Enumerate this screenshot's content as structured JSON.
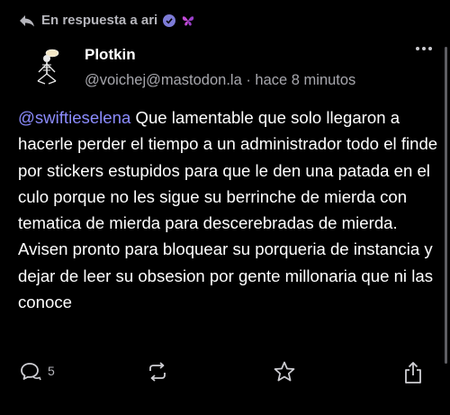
{
  "reply_context": {
    "label": "En respuesta a ari",
    "arrow_icon": "reply-arrow-icon",
    "badges": [
      "verified-check-icon",
      "butterfly-emoji-icon"
    ]
  },
  "author": {
    "display_name": "Plotkin",
    "handle_and_time": "@voichej@mastodon.la · hace 8 minutos"
  },
  "post": {
    "mention": "@swiftieselena",
    "text": " Que lamentable que solo llegaron a hacerle perder el tiempo a un administrador todo el finde por stickers estupidos para que le den una patada en el culo porque no les sigue su berrinche de mierda con tematica de mierda para descerebradas de mierda.",
    "text2": "Avisen pronto para bloquear su porqueria de instancia y dejar de leer su obsesion por gente millonaria que ni las conoce"
  },
  "actions": {
    "reply_count": "5",
    "icons": [
      "reply-icon",
      "boost-icon",
      "favorite-star-icon",
      "share-icon"
    ]
  },
  "colors": {
    "background": "#000000",
    "mention": "#8c8cff",
    "muted": "#a7a7ad",
    "verified": "#7d7bd6",
    "butterfly": "#c24ad6"
  }
}
